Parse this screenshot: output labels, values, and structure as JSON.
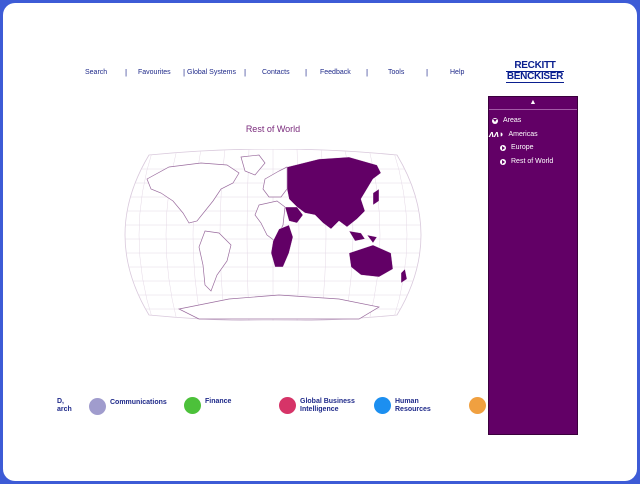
{
  "nav": {
    "items": [
      "Search",
      "Favourites",
      "Global Systems",
      "Contacts",
      "Feedback",
      "Tools",
      "Help"
    ],
    "separator": "|"
  },
  "brand": {
    "line1": "RECKITT",
    "line2": "BENCKISER"
  },
  "map": {
    "title": "Rest of World"
  },
  "side_menu": {
    "up_arrow": "▲",
    "items": [
      "Areas",
      "Americas",
      "Europe",
      "Rest of World"
    ]
  },
  "departments": {
    "partial_left": [
      "D,",
      "arch"
    ],
    "communications": "Communications",
    "finance": "Finance",
    "gbi_line1": "Global Business",
    "gbi_line2": "Intelligence",
    "hr_line1": "Human",
    "hr_line2": "Resources"
  },
  "colors": {
    "brand_purple": "#620066",
    "communications": "#a09ccd",
    "finance": "#4cc13a",
    "gbi": "#d63468",
    "hr": "#1c8ff0",
    "orange": "#f0a040"
  }
}
